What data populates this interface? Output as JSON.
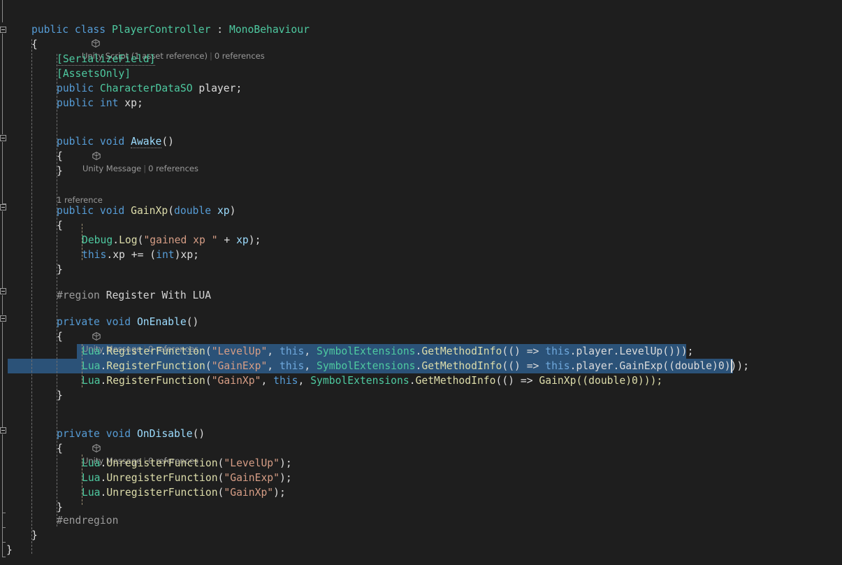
{
  "editor": {
    "language": "C#",
    "theme": "dark",
    "background_color": "#1e1e1e",
    "selection_color": "#2b5278",
    "caret_color": "#d8d8d8"
  },
  "codelens": {
    "class_header": {
      "icon": "unity-cube-icon",
      "unity_label": "Unity Script (1 asset reference)",
      "references": "0 references"
    },
    "awake": {
      "icon": "unity-cube-icon",
      "unity_label": "Unity Message",
      "references": "0 references"
    },
    "gainxp": {
      "references": "1 reference"
    },
    "onenable": {
      "icon": "unity-cube-icon",
      "unity_label": "Unity Message",
      "references": "0 references"
    },
    "ondisable": {
      "icon": "unity-cube-icon",
      "unity_label": "Unity Message",
      "references": "0 references"
    }
  },
  "code": {
    "class_decl": {
      "k_public": "public",
      "k_class": "class",
      "name": "PlayerController",
      "colon": ":",
      "base": "MonoBehaviour"
    },
    "brace_open": "{",
    "brace_close": "}",
    "attr_serializefield": "[SerializeField]",
    "attr_assetsonly": "[AssetsOnly]",
    "field_player": {
      "k_public": "public",
      "type": "CharacterDataSO",
      "name": "player;"
    },
    "field_xp": {
      "k_public": "public",
      "type": "int",
      "name": "xp;"
    },
    "awake_sig": {
      "k_public": "public",
      "k_void": "void",
      "name": "Awake",
      "parens": "()"
    },
    "gainxp_sig": {
      "k_public": "public",
      "k_void": "void",
      "name": "GainXp",
      "open": "(",
      "param_type": "double",
      "param_name": "xp",
      "close": ")"
    },
    "debug_log": {
      "type": "Debug",
      "dot": ".",
      "method": "Log",
      "open": "(",
      "string": "\"gained xp \"",
      "plus": "+",
      "arg": "xp",
      "close": ");"
    },
    "this_xp": {
      "k_this": "this",
      "rest": ".xp += (",
      "k_int": "int",
      "tail": ")xp;"
    },
    "region_start": {
      "directive": "#region",
      "label": "Register With LUA"
    },
    "region_end": "#endregion",
    "onenable_sig": {
      "k_private": "private",
      "k_void": "void",
      "name": "OnEnable",
      "parens": "()"
    },
    "ondisable_sig": {
      "k_private": "private",
      "k_void": "void",
      "name": "OnDisable",
      "parens": "()"
    },
    "register_lines": [
      {
        "lua": "Lua",
        "method": "RegisterFunction",
        "name_string": "\"LevelUp\"",
        "this": "this",
        "symbol_type": "SymbolExtensions",
        "symbol_method": "GetMethodInfo",
        "lambda": "() =>",
        "body_this": "this",
        "body_rest": ".player.LevelUp()));",
        "selected": true
      },
      {
        "lua": "Lua",
        "method": "RegisterFunction",
        "name_string": "\"GainExp\"",
        "this": "this",
        "symbol_type": "SymbolExtensions",
        "symbol_method": "GetMethodInfo",
        "lambda": "() =>",
        "body_this": "this",
        "body_rest": ".player.GainExp((double)0)));",
        "selected": true
      },
      {
        "lua": "Lua",
        "method": "RegisterFunction",
        "name_string": "\"GainXp\"",
        "this": "this",
        "symbol_type": "SymbolExtensions",
        "symbol_method": "GetMethodInfo",
        "lambda": "() =>",
        "body_this": "",
        "body_rest": "GainXp((double)0)));",
        "selected": false
      }
    ],
    "unregister_lines": [
      {
        "lua": "Lua",
        "method": "UnregisterFunction",
        "name_string": "\"LevelUp\"",
        "tail": ");"
      },
      {
        "lua": "Lua",
        "method": "UnregisterFunction",
        "name_string": "\"GainExp\"",
        "tail": ");"
      },
      {
        "lua": "Lua",
        "method": "UnregisterFunction",
        "name_string": "\"GainXp\"",
        "tail": ");"
      }
    ]
  }
}
